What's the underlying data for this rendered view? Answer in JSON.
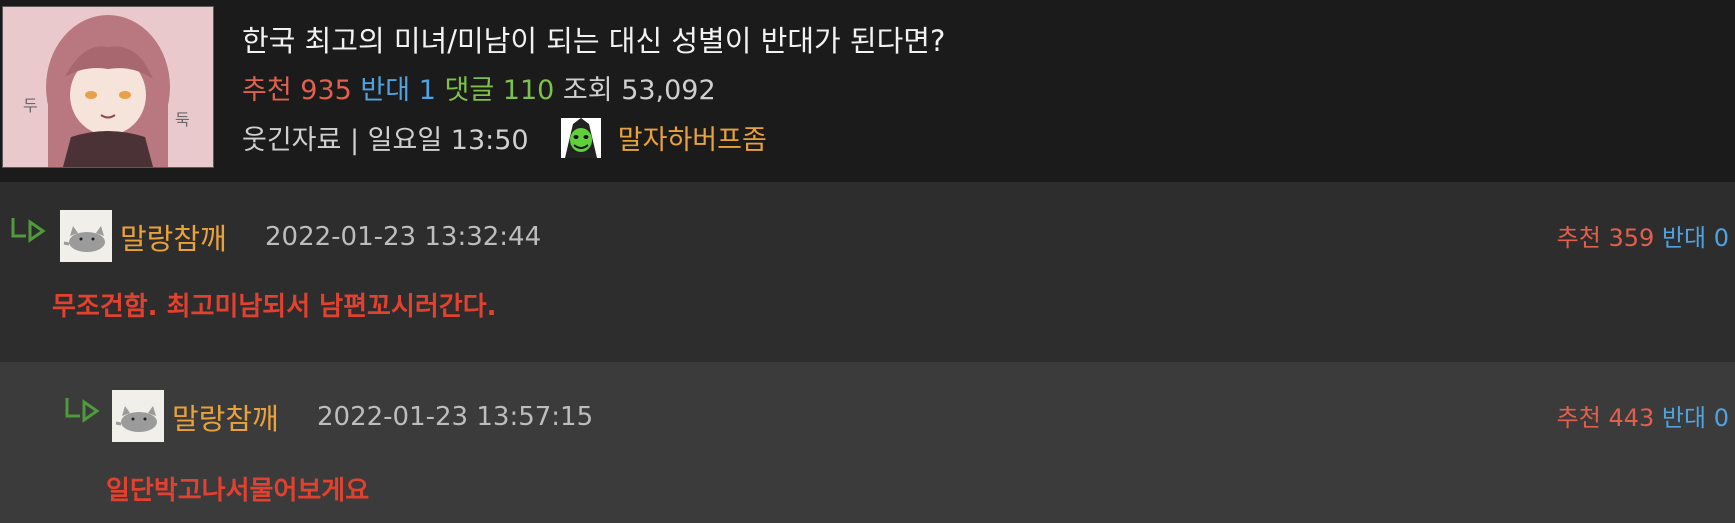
{
  "post": {
    "title": "한국 최고의 미녀/미남이 되는 대신 성별이 반대가 된다면?",
    "stats": {
      "recommend_label": "추천",
      "recommend_count": "935",
      "oppose_label": "반대",
      "oppose_count": "1",
      "comment_label": "댓글",
      "comment_count": "110",
      "view_label": "조회",
      "view_count": "53,092"
    },
    "category": "웃긴자료",
    "separator": "|",
    "posted_time": "일요일 13:50",
    "author": "말자하버프좀",
    "icons": {
      "thumbnail": "anime-girl-thumbnail",
      "author_icon": "green-character-icon"
    }
  },
  "comments": [
    {
      "nickname": "말랑참깨",
      "timestamp": "2022-01-23 13:32:44",
      "recommend_label": "추천",
      "recommend_count": "359",
      "oppose_label": "반대",
      "oppose_count": "0",
      "body": "무조건함. 최고미남되서 남편꼬시러간다.",
      "icons": {
        "reply": "reply-arrow-icon",
        "avatar": "cat-avatar"
      }
    },
    {
      "nickname": "말랑참깨",
      "timestamp": "2022-01-23 13:57:15",
      "recommend_label": "추천",
      "recommend_count": "443",
      "oppose_label": "반대",
      "oppose_count": "0",
      "body": "일단박고나서물어보게요",
      "icons": {
        "reply": "reply-arrow-icon",
        "avatar": "cat-avatar"
      }
    }
  ],
  "colors": {
    "recommend": "#e0604d",
    "oppose": "#4ea3e0",
    "comment_count": "#7dc04a",
    "nickname": "#e9a23b",
    "comment_body": "#e2412f"
  }
}
